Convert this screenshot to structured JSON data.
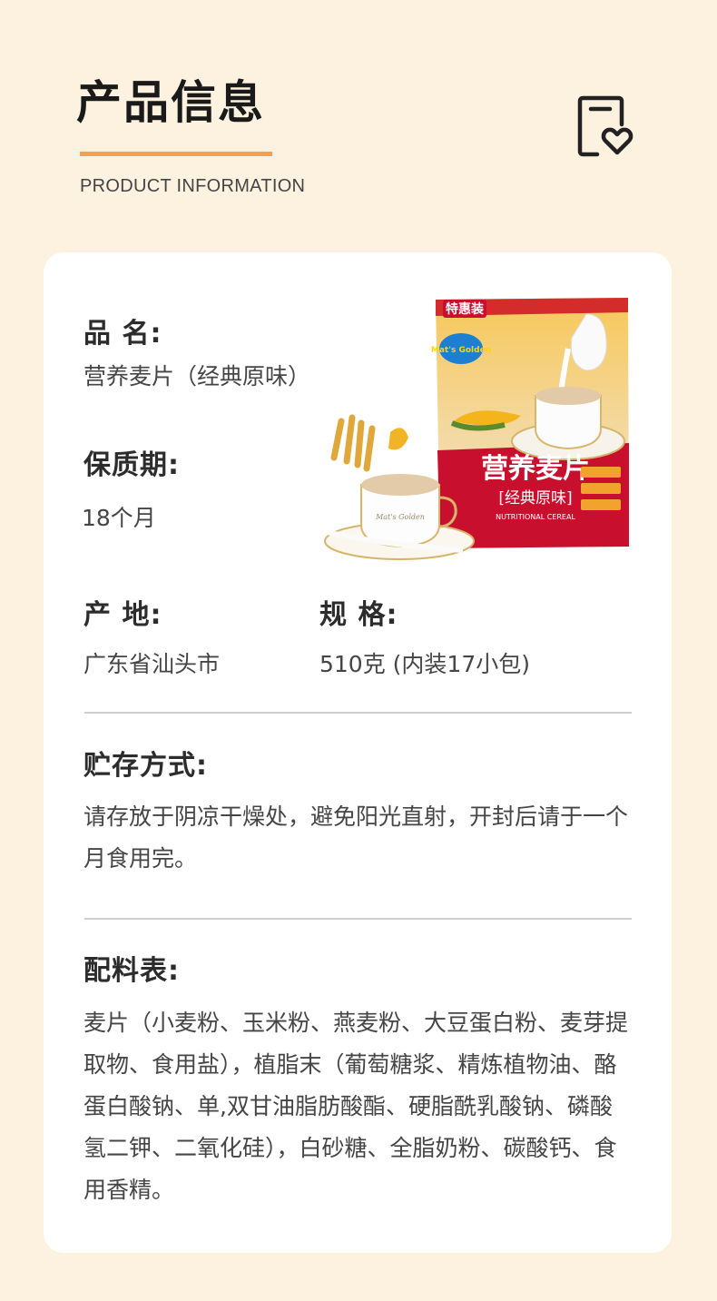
{
  "header": {
    "title": "产品信息",
    "subtitle": "PRODUCT INFORMATION",
    "icon": "document-heart-icon",
    "accent_color": "#f5a04c"
  },
  "product_image": {
    "brand_logo": "Mat's Golden",
    "badge": "特惠装",
    "package_title": "营养麦片",
    "package_subtitle": "[经典原味]",
    "package_english": "NUTRITIONAL CEREAL",
    "cup_text": "Mat's Golden",
    "pack_color": "#c8102e"
  },
  "info": {
    "name_label": "品  名:",
    "name_value": "营养麦片（经典原味）",
    "shelf_label": "保质期:",
    "shelf_value": "18个月",
    "origin_label": "产  地:",
    "origin_value": "广东省汕头市",
    "spec_label": "规  格:",
    "spec_value": "510克 (内装17小包)"
  },
  "storage": {
    "label": "贮存方式:",
    "text": "请存放于阴凉干燥处，避免阳光直射，开封后请于一个月食用完。"
  },
  "ingredients": {
    "label": "配料表:",
    "text": "麦片（小麦粉、玉米粉、燕麦粉、大豆蛋白粉、麦芽提取物、食用盐），植脂末（葡萄糖浆、精炼植物油、酪蛋白酸钠、单,双甘油脂肪酸酯、硬脂酰乳酸钠、磷酸氢二钾、二氧化硅），白砂糖、全脂奶粉、碳酸钙、食用香精。"
  }
}
